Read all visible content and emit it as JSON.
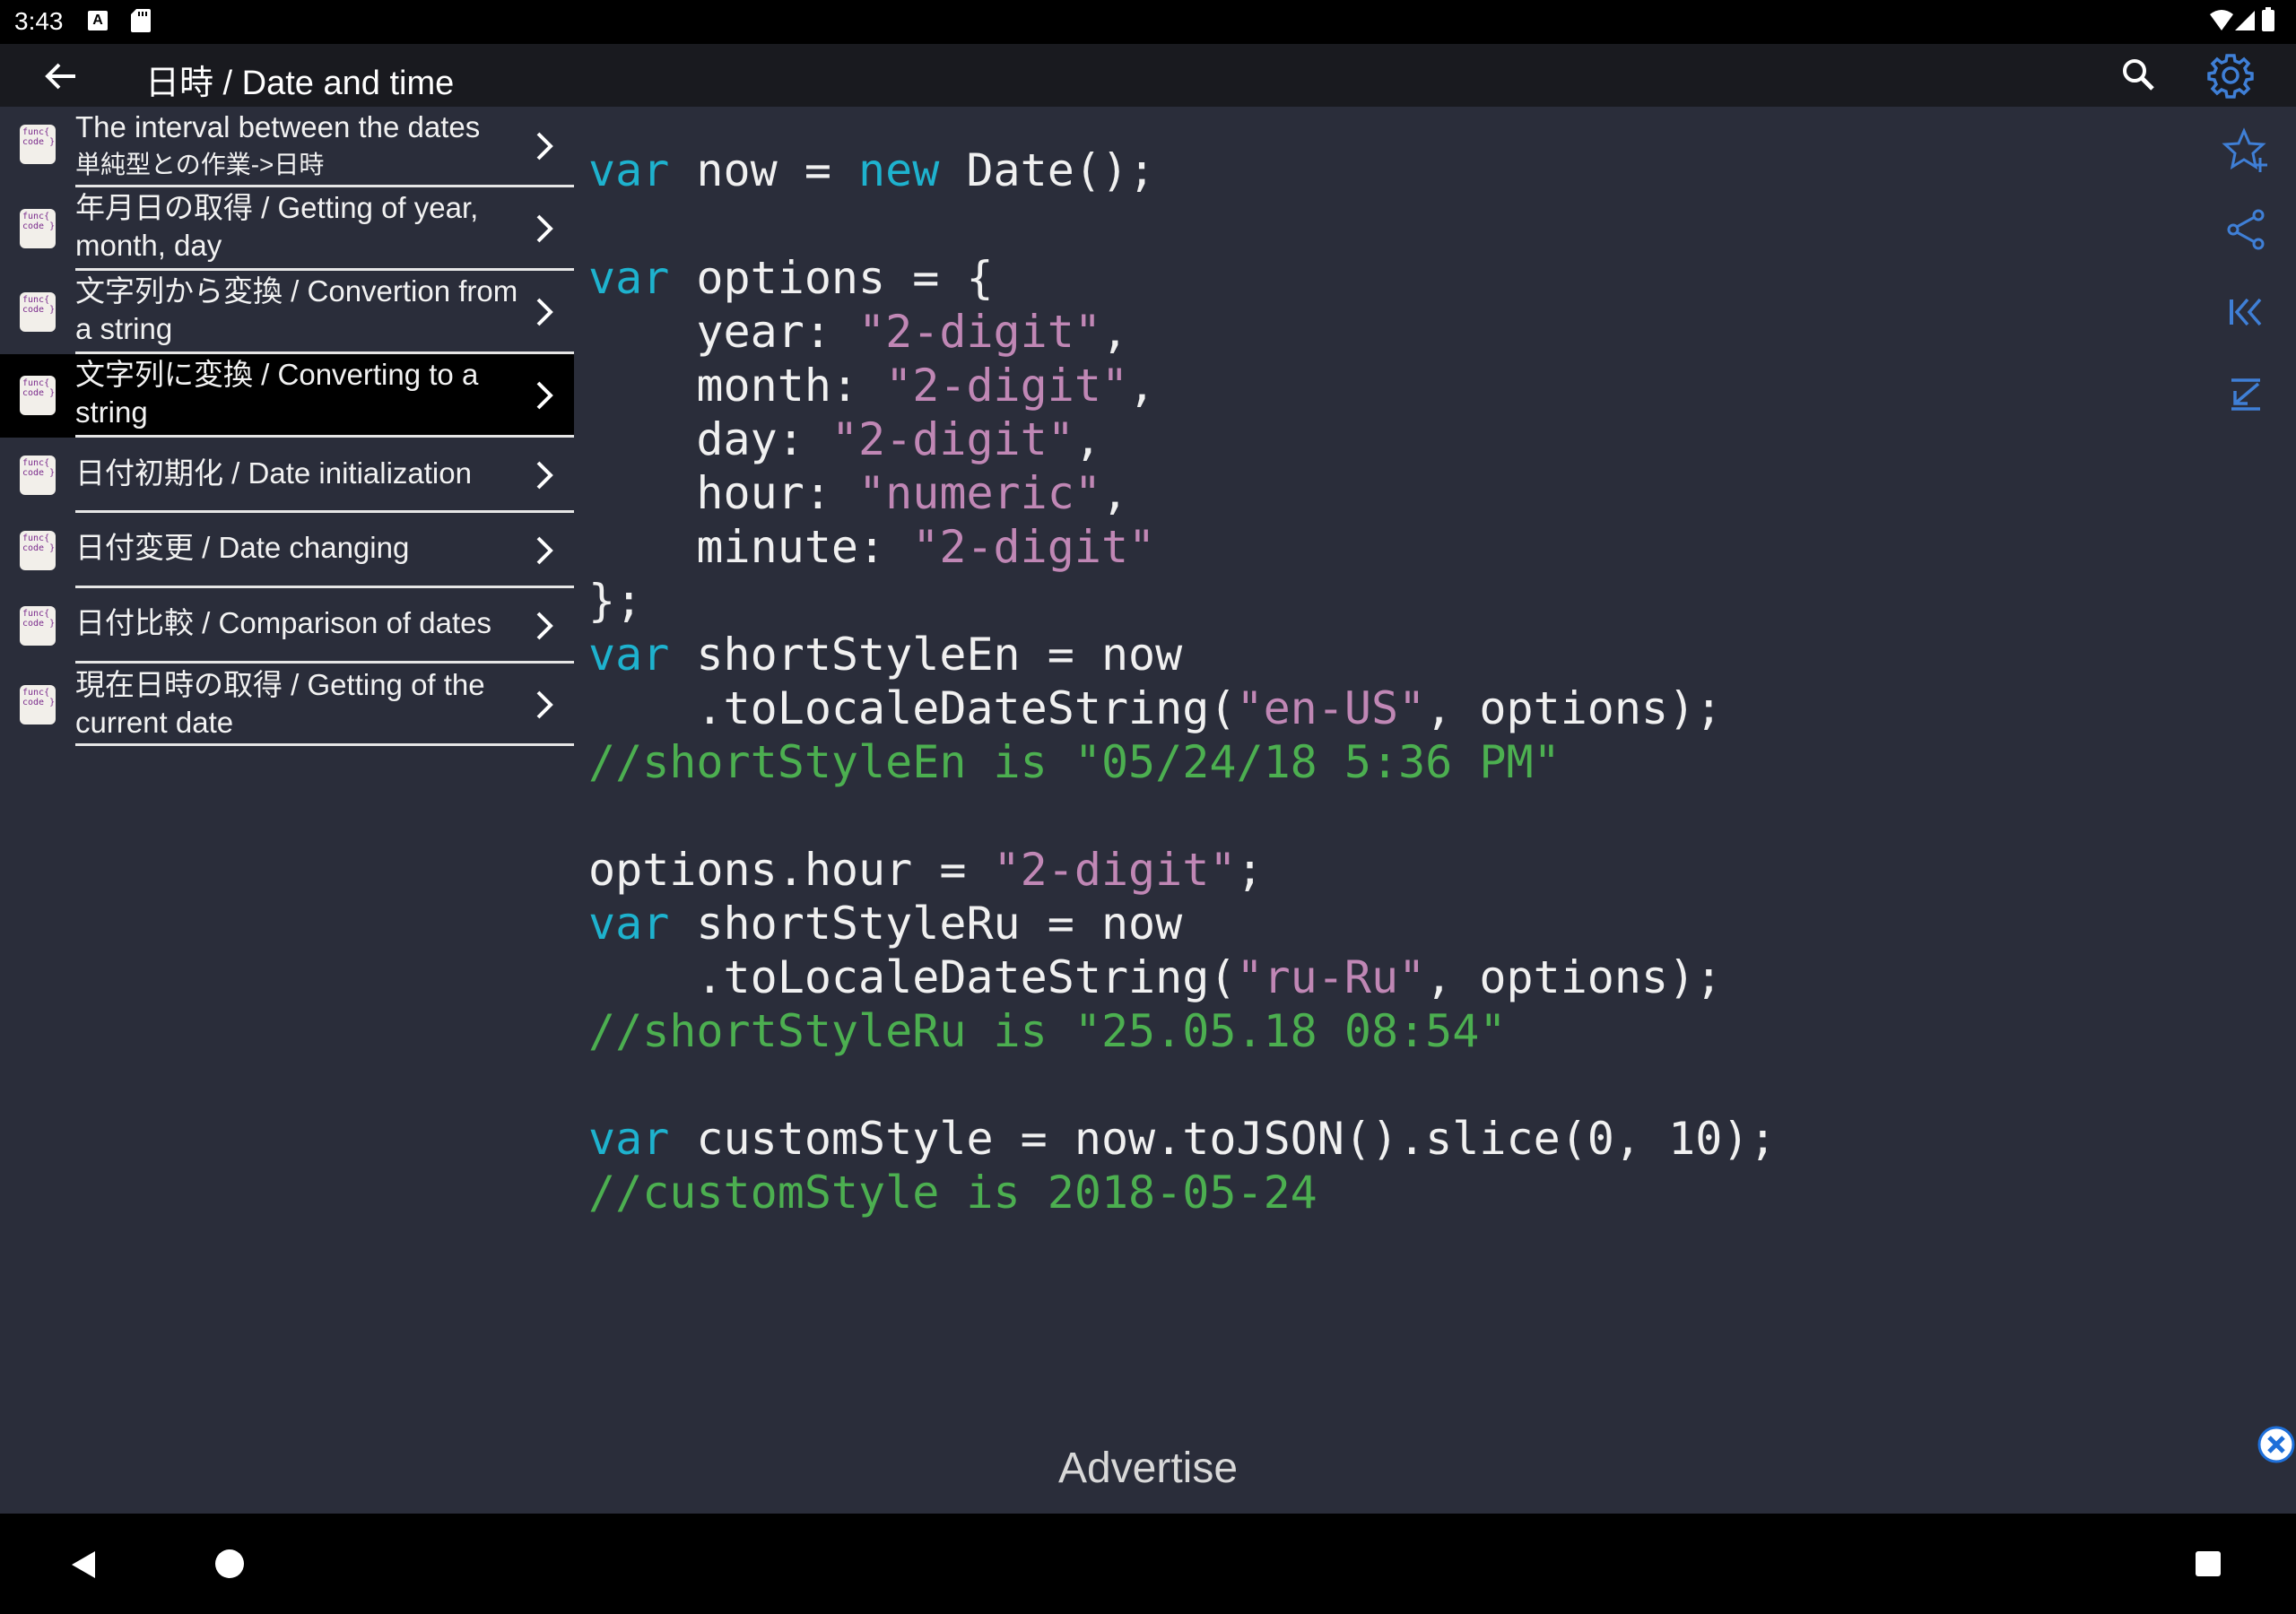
{
  "status_bar": {
    "time": "3:43",
    "badge_a": "A"
  },
  "app_bar": {
    "title": "日時 / Date and time"
  },
  "list": {
    "items": [
      {
        "title": "The interval between the dates",
        "subtitle": "単純型との作業->日時",
        "icon_text": "func{ code }"
      },
      {
        "title": "年月日の取得 / Getting of year,",
        "subtitle": "month, day",
        "icon_text": "func{ code }"
      },
      {
        "title": "文字列から変換 / Convertion from",
        "subtitle": "a string",
        "icon_text": "func{ code }"
      },
      {
        "title": "文字列に変換 / Converting to a",
        "subtitle": "string",
        "icon_text": "func{ code }",
        "active": true
      },
      {
        "title": "日付初期化 / Date initialization",
        "subtitle": "",
        "icon_text": "func{ code }"
      },
      {
        "title": "日付変更 / Date changing",
        "subtitle": "",
        "icon_text": "func{ code }"
      },
      {
        "title": "日付比較 / Comparison of dates",
        "subtitle": "",
        "icon_text": "func{ code }"
      },
      {
        "title": "現在日時の取得 / Getting of the",
        "subtitle": "current date",
        "icon_text": "func{ code }"
      }
    ]
  },
  "code": {
    "lines": [
      [
        [
          "kw",
          "var"
        ],
        [
          "pl",
          " now = "
        ],
        [
          "kw",
          "new"
        ],
        [
          "pl",
          " Date();"
        ]
      ],
      [],
      [
        [
          "kw",
          "var"
        ],
        [
          "pl",
          " options = {"
        ]
      ],
      [
        [
          "pl",
          "    year: "
        ],
        [
          "str",
          "\"2-digit\""
        ],
        [
          "pl",
          ","
        ]
      ],
      [
        [
          "pl",
          "    month: "
        ],
        [
          "str",
          "\"2-digit\""
        ],
        [
          "pl",
          ","
        ]
      ],
      [
        [
          "pl",
          "    day: "
        ],
        [
          "str",
          "\"2-digit\""
        ],
        [
          "pl",
          ","
        ]
      ],
      [
        [
          "pl",
          "    hour: "
        ],
        [
          "str",
          "\"numeric\""
        ],
        [
          "pl",
          ","
        ]
      ],
      [
        [
          "pl",
          "    minute: "
        ],
        [
          "str",
          "\"2-digit\""
        ]
      ],
      [
        [
          "pl",
          "};"
        ]
      ],
      [
        [
          "kw",
          "var"
        ],
        [
          "pl",
          " shortStyleEn = now"
        ]
      ],
      [
        [
          "pl",
          "    .toLocaleDateString("
        ],
        [
          "str",
          "\"en-US\""
        ],
        [
          "pl",
          ", options);"
        ]
      ],
      [
        [
          "cm",
          "//shortStyleEn is \"05/24/18 5:36 PM\""
        ]
      ],
      [],
      [
        [
          "pl",
          "options.hour = "
        ],
        [
          "str",
          "\"2-digit\""
        ],
        [
          "pl",
          ";"
        ]
      ],
      [
        [
          "kw",
          "var"
        ],
        [
          "pl",
          " shortStyleRu = now"
        ]
      ],
      [
        [
          "pl",
          "    .toLocaleDateString("
        ],
        [
          "str",
          "\"ru-Ru\""
        ],
        [
          "pl",
          ", options);"
        ]
      ],
      [
        [
          "cm",
          "//shortStyleRu is \"25.05.18 08:54\""
        ]
      ],
      [],
      [
        [
          "kw",
          "var"
        ],
        [
          "pl",
          " customStyle = now.toJSON().slice(0, 10);"
        ]
      ],
      [
        [
          "cm",
          "//customStyle is 2018-05-24"
        ]
      ]
    ]
  },
  "ad": {
    "label": "Advertise"
  },
  "colors": {
    "background": "#2a2d3a",
    "keyword": "#1eb2ce",
    "string": "#c087b5",
    "comment": "#4caf50",
    "accent": "#3f7fd6"
  }
}
